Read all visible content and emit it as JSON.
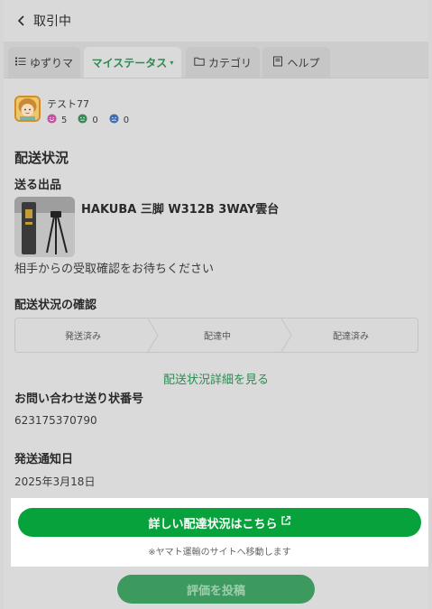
{
  "header": {
    "back_label": "取引中"
  },
  "tabs": [
    {
      "label": "ゆずりマ",
      "icon": "list-icon"
    },
    {
      "label": "マイステータス",
      "active": true
    },
    {
      "label": "カテゴリ",
      "icon": "folder-icon"
    },
    {
      "label": "ヘルプ",
      "icon": "book-icon"
    }
  ],
  "user": {
    "name": "テスト77",
    "ratings": [
      {
        "icon": "smile-face-icon",
        "count": "5",
        "color": "#c44fa3"
      },
      {
        "icon": "neutral-face-icon",
        "count": "0",
        "color": "#3a8a55"
      },
      {
        "icon": "sad-face-icon",
        "count": "0",
        "color": "#3f6fb0"
      }
    ]
  },
  "shipping": {
    "title": "配送状況",
    "item_heading": "送る出品",
    "item_title": "HAKUBA 三脚 W312B 3WAY雲台",
    "status_message": "相手からの受取確認をお待ちください",
    "confirm_heading": "配送状況の確認",
    "steps": [
      "発送済み",
      "配達中",
      "配達済み"
    ],
    "detail_link": "配送状況詳細を見る"
  },
  "tracking": {
    "heading": "お問い合わせ送り状番号",
    "number": "623175370790"
  },
  "notice": {
    "heading": "発送通知日",
    "date": "2025年3月18日"
  },
  "cta": {
    "label": "詳しい配達状況はこちら",
    "note": "※ヤマト運輸のサイトへ移動します"
  },
  "review_button": "評価を投稿",
  "colors": {
    "accent": "#07a23c",
    "link": "#2e8a52",
    "highlight": "#ffffff"
  }
}
